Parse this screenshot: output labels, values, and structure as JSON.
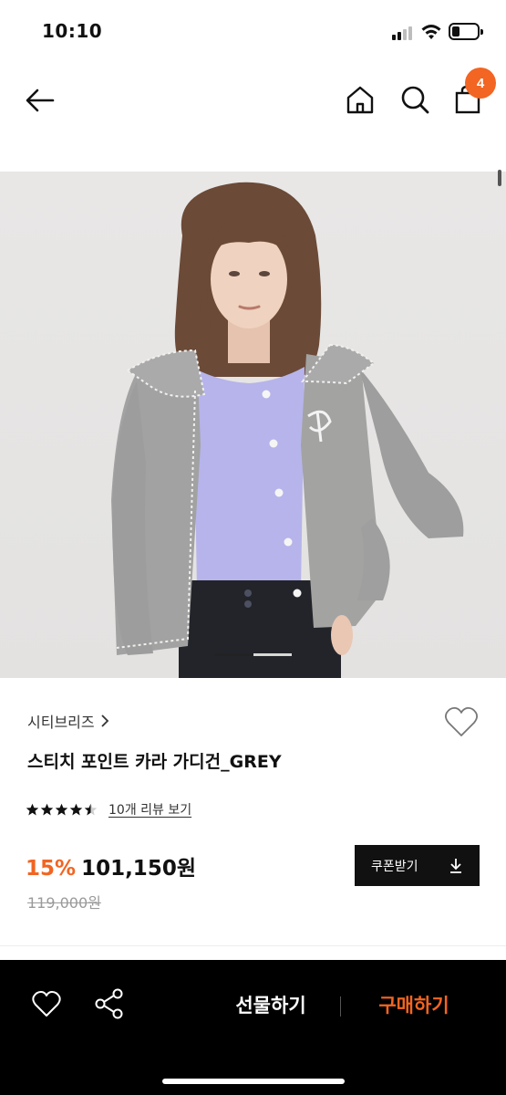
{
  "status_bar": {
    "time": "10:10",
    "battery_level": 0.3
  },
  "header": {
    "cart_count": "4",
    "accent_color": "#f26522"
  },
  "product": {
    "brand": "시티브리즈",
    "name": "스티치 포인트 카라 가디건_GREY",
    "rating": 4.5,
    "review_link": "10개 리뷰 보기",
    "discount": "15%",
    "price": "101,150원",
    "original_price": "119,000원",
    "coupon_button": "쿠폰받기",
    "image_index": 1,
    "image_total": 2
  },
  "bottom_bar": {
    "gift_button": "선물하기",
    "buy_button": "구매하기",
    "accent_color": "#f26522"
  },
  "icons": [
    "back-arrow-icon",
    "home-icon",
    "search-icon",
    "shopping-bag-icon",
    "heart-icon",
    "share-icon",
    "download-icon",
    "star-icon"
  ]
}
